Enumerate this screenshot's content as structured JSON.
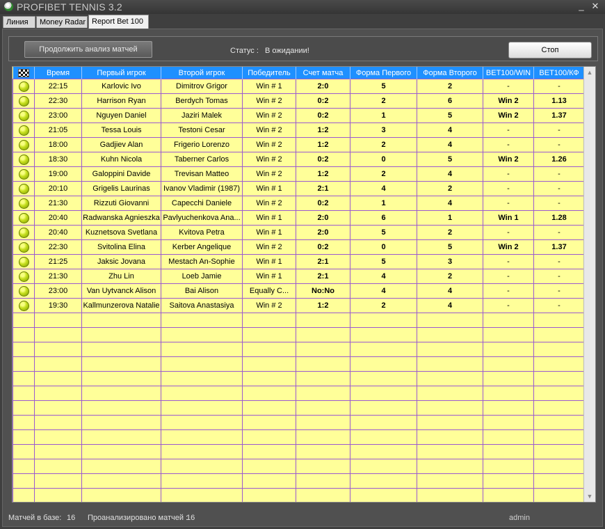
{
  "window": {
    "title": "PROFIBET TENNIS 3.2",
    "minimize_label": "_",
    "close_label": "✕"
  },
  "tabs": [
    {
      "label": "Линия",
      "active": false
    },
    {
      "label": "Money Radar",
      "active": false
    },
    {
      "label": "Report Bet 100",
      "active": true
    }
  ],
  "toolbar": {
    "continue_label": "Продолжить анализ матчей",
    "status_label": "Статус :",
    "status_value": "В ожидании!",
    "stop_label": "Стоп"
  },
  "table": {
    "columns": [
      "",
      "Время",
      "Первый игрок",
      "Второй игрок",
      "Победитель",
      "Счет матча",
      "Форма Первого",
      "Форма Второго",
      "BET100/WIN",
      "BET100/КФ"
    ],
    "rows": [
      {
        "time": "22:15",
        "p1": "Karlovic Ivo",
        "p2": "Dimitrov Grigor",
        "winner": "Win # 1",
        "score": "2:0",
        "f1": "5",
        "f2": "2",
        "bw": "-",
        "kf": "-"
      },
      {
        "time": "22:30",
        "p1": "Harrison Ryan",
        "p2": "Berdych Tomas",
        "winner": "Win # 2",
        "score": "0:2",
        "f1": "2",
        "f2": "6",
        "bw": "Win 2",
        "kf": "1.13"
      },
      {
        "time": "23:00",
        "p1": "Nguyen Daniel",
        "p2": "Jaziri Malek",
        "winner": "Win # 2",
        "score": "0:2",
        "f1": "1",
        "f2": "5",
        "bw": "Win 2",
        "kf": "1.37"
      },
      {
        "time": "21:05",
        "p1": "Tessa Louis",
        "p2": "Testoni Cesar",
        "winner": "Win # 2",
        "score": "1:2",
        "f1": "3",
        "f2": "4",
        "bw": "-",
        "kf": "-"
      },
      {
        "time": "18:00",
        "p1": "Gadjiev Alan",
        "p2": "Frigerio Lorenzo",
        "winner": "Win # 2",
        "score": "1:2",
        "f1": "2",
        "f2": "4",
        "bw": "-",
        "kf": "-"
      },
      {
        "time": "18:30",
        "p1": "Kuhn Nicola",
        "p2": "Taberner Carlos",
        "winner": "Win # 2",
        "score": "0:2",
        "f1": "0",
        "f2": "5",
        "bw": "Win 2",
        "kf": "1.26"
      },
      {
        "time": "19:00",
        "p1": "Galoppini Davide",
        "p2": "Trevisan Matteo",
        "winner": "Win # 2",
        "score": "1:2",
        "f1": "2",
        "f2": "4",
        "bw": "-",
        "kf": "-"
      },
      {
        "time": "20:10",
        "p1": "Grigelis Laurinas",
        "p2": "Ivanov Vladimir (1987)",
        "winner": "Win # 1",
        "score": "2:1",
        "f1": "4",
        "f2": "2",
        "bw": "-",
        "kf": "-"
      },
      {
        "time": "21:30",
        "p1": "Rizzuti Giovanni",
        "p2": "Capecchi Daniele",
        "winner": "Win # 2",
        "score": "0:2",
        "f1": "1",
        "f2": "4",
        "bw": "-",
        "kf": "-"
      },
      {
        "time": "20:40",
        "p1": "Radwanska Agnieszka",
        "p2": "Pavlyuchenkova Ana...",
        "winner": "Win # 1",
        "score": "2:0",
        "f1": "6",
        "f2": "1",
        "bw": "Win 1",
        "kf": "1.28"
      },
      {
        "time": "20:40",
        "p1": "Kuznetsova Svetlana",
        "p2": "Kvitova Petra",
        "winner": "Win # 1",
        "score": "2:0",
        "f1": "5",
        "f2": "2",
        "bw": "-",
        "kf": "-"
      },
      {
        "time": "22:30",
        "p1": "Svitolina Elina",
        "p2": "Kerber Angelique",
        "winner": "Win # 2",
        "score": "0:2",
        "f1": "0",
        "f2": "5",
        "bw": "Win 2",
        "kf": "1.37"
      },
      {
        "time": "21:25",
        "p1": "Jaksic Jovana",
        "p2": "Mestach An-Sophie",
        "winner": "Win # 1",
        "score": "2:1",
        "f1": "5",
        "f2": "3",
        "bw": "-",
        "kf": "-"
      },
      {
        "time": "21:30",
        "p1": "Zhu Lin",
        "p2": "Loeb Jamie",
        "winner": "Win # 1",
        "score": "2:1",
        "f1": "4",
        "f2": "2",
        "bw": "-",
        "kf": "-"
      },
      {
        "time": "23:00",
        "p1": "Van Uytvanck Alison",
        "p2": "Bai Alison",
        "winner": "Equally C...",
        "score": "No:No",
        "f1": "4",
        "f2": "4",
        "bw": "-",
        "kf": "-"
      },
      {
        "time": "19:30",
        "p1": "Kallmunzerova Natalie",
        "p2": "Saitova Anastasiya",
        "winner": "Win # 2",
        "score": "1:2",
        "f1": "2",
        "f2": "4",
        "bw": "-",
        "kf": "-"
      }
    ],
    "empty_rows": 13
  },
  "statusbar": {
    "matches_label": "Матчей в базе:",
    "matches_value": "16",
    "analyzed_label": "Проанализировано матчей :",
    "analyzed_value": "16",
    "user": "admin"
  },
  "colors": {
    "header_bg": "#1e90ff",
    "grid_bg": "#ffff99",
    "grid_line": "#9b59d0",
    "win_text": "#2e8b2e",
    "score_text": "#dd0000",
    "kf_text": "#0b8a6b"
  },
  "icons": {
    "app": "tennis-ball-icon",
    "header_first_col": "checkered-flag-icon",
    "row": "tennis-ball-icon"
  }
}
